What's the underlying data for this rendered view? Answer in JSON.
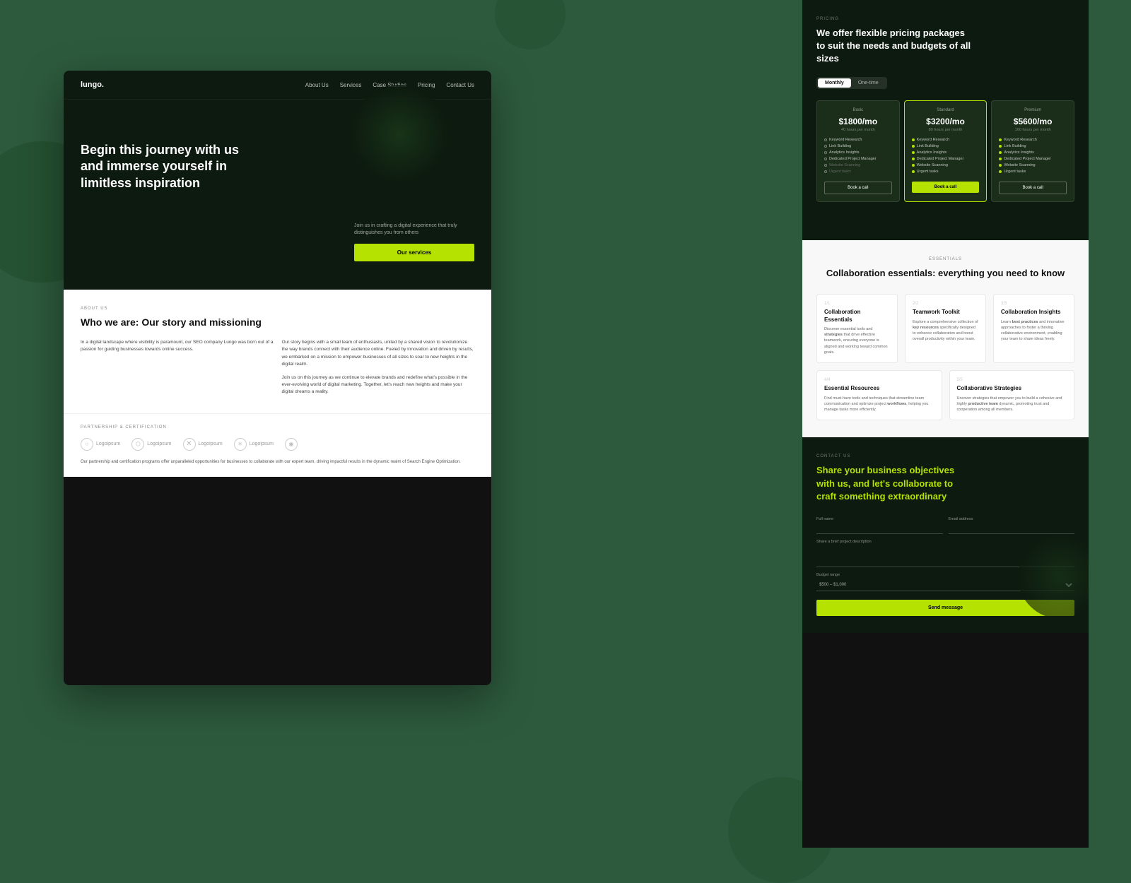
{
  "background": "#2d5a3d",
  "left_panel": {
    "nav": {
      "logo": "lungo.",
      "links": [
        "About Us",
        "Services",
        "Case Studies",
        "Pricing",
        "Contact Us"
      ]
    },
    "hero": {
      "title": "Begin this journey with us and immerse yourself in limitless inspiration",
      "subtitle": "Join us in crafting a digital experience that truly distinguishes you from others",
      "cta_label": "Our services"
    },
    "about": {
      "label": "ABOUT US",
      "title": "Who we are: Our story and missioning",
      "para1": "In a digital landscape where visibility is paramount, our SEO company Lungo was born out of a passion for guiding businesses towards online success.",
      "para2": "Our story begins with a small team of enthusiasts, united by a shared vision to revolutionize the way brands connect with their audience online. Fueled by innovation and driven by results, we embarked on a mission to empower businesses of all sizes to soar to new heights in the digital realm.",
      "para3": "Join us on this journey as we continue to elevate brands and redefine what's possible in the ever-evolving world of digital marketing. Together, let's reach new heights and make your digital dreams a reality.",
      "bold_words": [
        "workflows"
      ]
    },
    "partnership": {
      "label": "PARTNERSHIP & CERTIFICATION",
      "logos": [
        "Logoipsum",
        "Logoipsum",
        "Logoipsum",
        "Logoipsum",
        ""
      ],
      "description": "Our partnership and certification programs offer unparalleled opportunities for businesses to collaborate with our expert team, driving impactful results in the dynamic realm of Search Engine Optimization."
    }
  },
  "right_panel": {
    "pricing": {
      "label": "PRICING",
      "title": "We offer flexible pricing packages to suit the needs and budgets of all sizes",
      "toggle": {
        "monthly": "Monthly",
        "onetime": "One-time",
        "active": "monthly"
      },
      "plans": [
        {
          "tier": "Basic",
          "price": "$1800/mo",
          "hours": "40 hours per month",
          "features": [
            "Keyword Research",
            "Link Building",
            "Analytics Insights",
            "Dedicated Project Manager",
            "Website Scanning",
            "Urgent tasks"
          ],
          "cta": "Book a call",
          "style": "outline"
        },
        {
          "tier": "Standard",
          "price": "$3200/mo",
          "hours": "80 hours per month",
          "features": [
            "Keyword Research",
            "Link Building",
            "Analytics Insights",
            "Dedicated Project Manager",
            "Website Scanning",
            "Urgent tasks"
          ],
          "cta": "Book a call",
          "style": "green"
        },
        {
          "tier": "Premium",
          "price": "$5600/mo",
          "hours": "160 hours per month",
          "features": [
            "Keyword Research",
            "Link Building",
            "Analytics Insights",
            "Dedicated Project Manager",
            "Website Scanning",
            "Urgent tasks"
          ],
          "cta": "Book a call",
          "style": "outline"
        }
      ]
    },
    "collaboration": {
      "label": "ESSENTIALS",
      "title": "Collaboration essentials: everything you need to know",
      "cards": [
        {
          "num": "1/1",
          "title": "Collaboration Essentials",
          "desc": "Discover essential tools and strategies that drive effective teamwork, ensuring everyone is aligned and working toward common goals."
        },
        {
          "num": "2/2",
          "title": "Teamwork Toolkit",
          "desc": "Explore a comprehensive collection of key resources specifically designed to enhance collaboration and boost overall productivity within your team."
        },
        {
          "num": "3/3",
          "title": "Collaboration Insights",
          "desc": "Learn best practices and innovative approaches to foster a thriving collaborative environment, enabling your team to share ideas freely."
        },
        {
          "num": "4/4",
          "title": "Essential Resources",
          "desc": "Find must-have tools and techniques that streamline team communication and optimize project workflows, helping you manage tasks more efficiently."
        },
        {
          "num": "5/5",
          "title": "Collaborative Strategies",
          "desc": "Uncover strategies that empower you to build a cohesive and highly productive team dynamic, promoting trust and cooperation among all members."
        }
      ]
    },
    "contact": {
      "label": "CONTACT US",
      "title": "Share your business objectives with us, and let's collaborate to craft something extraordinary",
      "form": {
        "full_name_label": "Full name",
        "email_label": "Email address",
        "project_label": "Share a brief project description",
        "budget_label": "Budget range",
        "budget_value": "$500 – $1,000",
        "send_label": "Send message"
      }
    }
  }
}
